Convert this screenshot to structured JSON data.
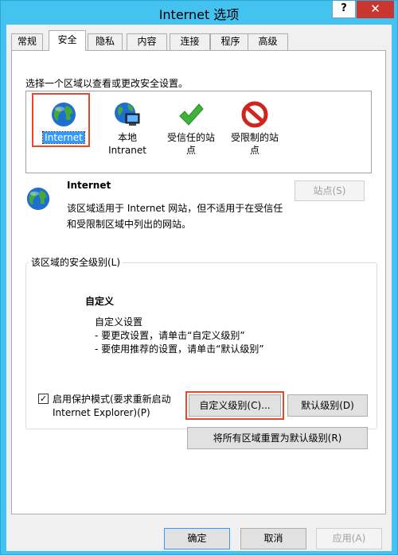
{
  "window": {
    "title": "Internet 选项",
    "help": "?",
    "close": "✕"
  },
  "tabs": [
    "常规",
    "安全",
    "隐私",
    "内容",
    "连接",
    "程序",
    "高级"
  ],
  "active_tab": "安全",
  "security": {
    "instruction": "选择一个区域以查看或更改安全设置。",
    "zones": [
      {
        "line1": "Internet",
        "line2": "",
        "icon": "globe-icon",
        "selected": true
      },
      {
        "line1": "本地",
        "line2": "Intranet",
        "icon": "globe-computer-icon",
        "selected": false
      },
      {
        "line1": "受信任的站",
        "line2": "点",
        "icon": "green-check-icon",
        "selected": false
      },
      {
        "line1": "受限制的站",
        "line2": "点",
        "icon": "red-prohibited-icon",
        "selected": false
      }
    ],
    "zone_title": "Internet",
    "zone_desc_line1": "该区域适用于 Internet 网站，但不适用于在受信任",
    "zone_desc_line2": "和受限制区域中列出的网站。",
    "sites_button": "站点(S)",
    "level_group_title": "该区域的安全级别(L)",
    "level_name": "自定义",
    "level_desc_1": "自定义设置",
    "level_desc_2": "- 要更改设置，请单击“自定义级别”",
    "level_desc_3": "- 要使用推荐的设置，请单击“默认级别”",
    "protected_mode_line1": "启用保护模式(要求重新启动",
    "protected_mode_line2": "Internet Explorer)(P)",
    "protected_mode_checked": true,
    "custom_level_button": "自定义级别(C)...",
    "default_level_button": "默认级别(D)",
    "reset_all_button": "将所有区域重置为默认级别(R)"
  },
  "footer": {
    "ok": "确定",
    "cancel": "取消",
    "apply": "应用(A)"
  },
  "colors": {
    "frame": "#44c2f0",
    "close": "#c7372f",
    "highlight_box": "#e8472b",
    "selection": "#3399ff"
  }
}
